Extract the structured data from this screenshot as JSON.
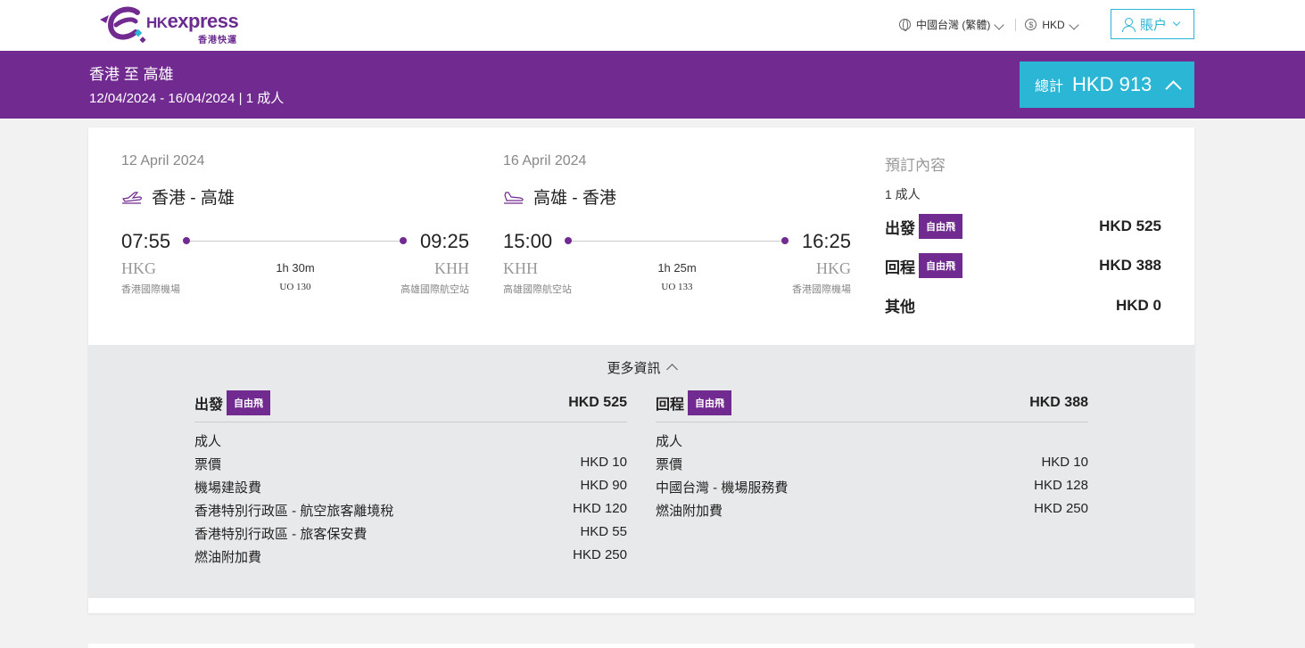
{
  "brand": {
    "name_hk": "HK",
    "name_express": "express",
    "sub": "香港快運"
  },
  "header": {
    "region": "中國台灣 (繁體)",
    "currency": "HKD",
    "account": "賬户"
  },
  "band": {
    "title": "香港 至 高雄",
    "subtitle": "12/04/2024 - 16/04/2024 | 1 成人",
    "total_label": "總計",
    "total_amount": "HKD 913"
  },
  "outbound": {
    "date": "12 April 2024",
    "route": "香港 - 高雄",
    "dep_time": "07:55",
    "arr_time": "09:25",
    "dep_code": "HKG",
    "arr_code": "KHH",
    "duration": "1h 30m",
    "flight": "UO 130",
    "dep_airport": "香港國際機場",
    "arr_airport": "高雄國際航空站"
  },
  "inbound": {
    "date": "16 April 2024",
    "route": "高雄 - 香港",
    "dep_time": "15:00",
    "arr_time": "16:25",
    "dep_code": "KHH",
    "arr_code": "HKG",
    "duration": "1h 25m",
    "flight": "UO 133",
    "dep_airport": "高雄國際航空站",
    "arr_airport": "香港國際機場"
  },
  "summary": {
    "title": "預訂內容",
    "pax": "1 成人",
    "depart_label": "出發",
    "depart_tag": "自由飛",
    "depart_amount": "HKD 525",
    "return_label": "回程",
    "return_tag": "自由飛",
    "return_amount": "HKD 388",
    "other_label": "其他",
    "other_amount": "HKD 0"
  },
  "details": {
    "toggle": "更多資訊",
    "outbound": {
      "label": "出發",
      "tag": "自由飛",
      "amount": "HKD 525",
      "section": "成人",
      "items": [
        {
          "label": "票價",
          "amount": "HKD 10"
        },
        {
          "label": "機場建設費",
          "amount": "HKD 90"
        },
        {
          "label": "香港特別行政區 - 航空旅客離境稅",
          "amount": "HKD 120"
        },
        {
          "label": "香港特別行政區 - 旅客保安費",
          "amount": "HKD 55"
        },
        {
          "label": "燃油附加費",
          "amount": "HKD 250"
        }
      ]
    },
    "inbound": {
      "label": "回程",
      "tag": "自由飛",
      "amount": "HKD 388",
      "section": "成人",
      "items": [
        {
          "label": "票價",
          "amount": "HKD 10"
        },
        {
          "label": "中國台灣 - 機場服務費",
          "amount": "HKD 128"
        },
        {
          "label": "燃油附加費",
          "amount": "HKD 250"
        }
      ]
    }
  },
  "colors": {
    "brand_purple": "#712a8f",
    "accent_cyan": "#2bb6d6",
    "logo_purple": "#6b2b8f"
  }
}
